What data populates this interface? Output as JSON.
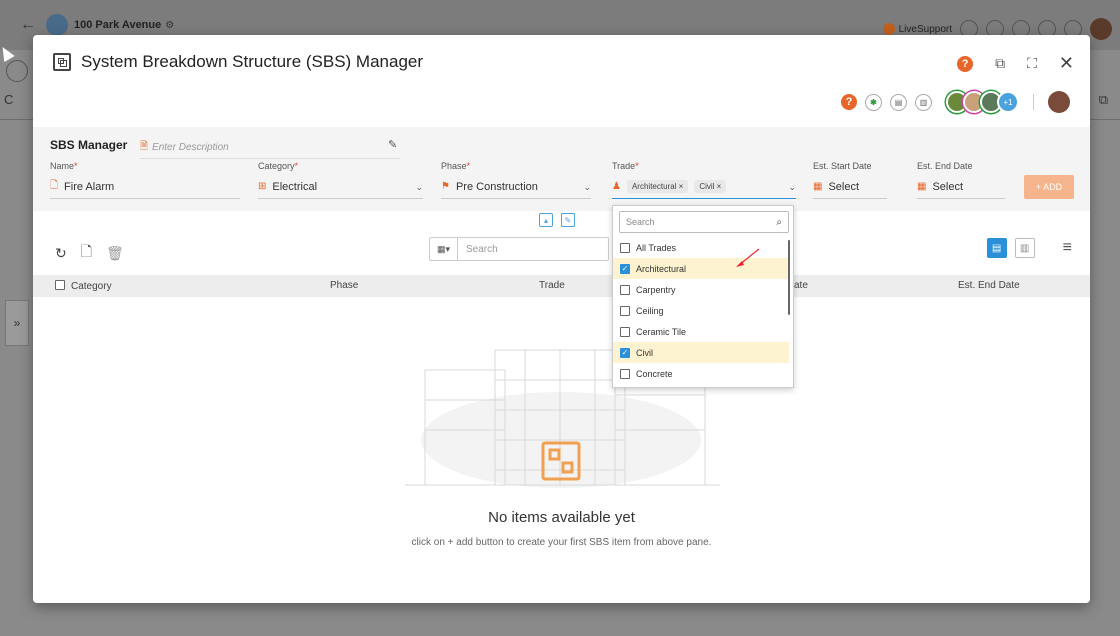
{
  "background": {
    "back_glyph": "←",
    "project_name": "100 Park Avenue",
    "live_support": "LiveSupport",
    "expand_glyph": "»"
  },
  "modal": {
    "title": "System Breakdown Structure (SBS) Manager",
    "help_badge": "?",
    "avatars_more": "+1"
  },
  "form": {
    "section_title": "SBS Manager",
    "description_placeholder": "Enter Description",
    "fields": {
      "name": {
        "label": "Name",
        "value": "Fire Alarm"
      },
      "category": {
        "label": "Category",
        "value": "Electrical"
      },
      "phase": {
        "label": "Phase",
        "value": "Pre Construction"
      },
      "trade": {
        "label": "Trade",
        "chips": [
          "Architectural",
          "Civil"
        ]
      },
      "start_date": {
        "label": "Est. Start Date",
        "value": "Select"
      },
      "end_date": {
        "label": "Est. End Date",
        "value": "Select"
      }
    },
    "required_mark": "*",
    "add_label": "+ ADD"
  },
  "toolbar": {
    "search_placeholder": "Search"
  },
  "table": {
    "headers": {
      "category": "Category",
      "phase": "Phase",
      "trade": "Trade",
      "start_partial": "ate",
      "end_date": "Est. End Date"
    }
  },
  "empty_state": {
    "title": "No items available yet",
    "subtitle": "click on + add button to create your first SBS item from above pane."
  },
  "trade_dropdown": {
    "search_placeholder": "Search",
    "options": [
      {
        "label": "All Trades",
        "checked": false
      },
      {
        "label": "Architectural",
        "checked": true
      },
      {
        "label": "Carpentry",
        "checked": false
      },
      {
        "label": "Ceiling",
        "checked": false
      },
      {
        "label": "Ceramic Tile",
        "checked": false
      },
      {
        "label": "Civil",
        "checked": true
      },
      {
        "label": "Concrete",
        "checked": false
      }
    ]
  },
  "colors": {
    "accent_orange": "#e8662a",
    "accent_blue": "#2a90d9",
    "selected_row": "#fdf3d0"
  }
}
